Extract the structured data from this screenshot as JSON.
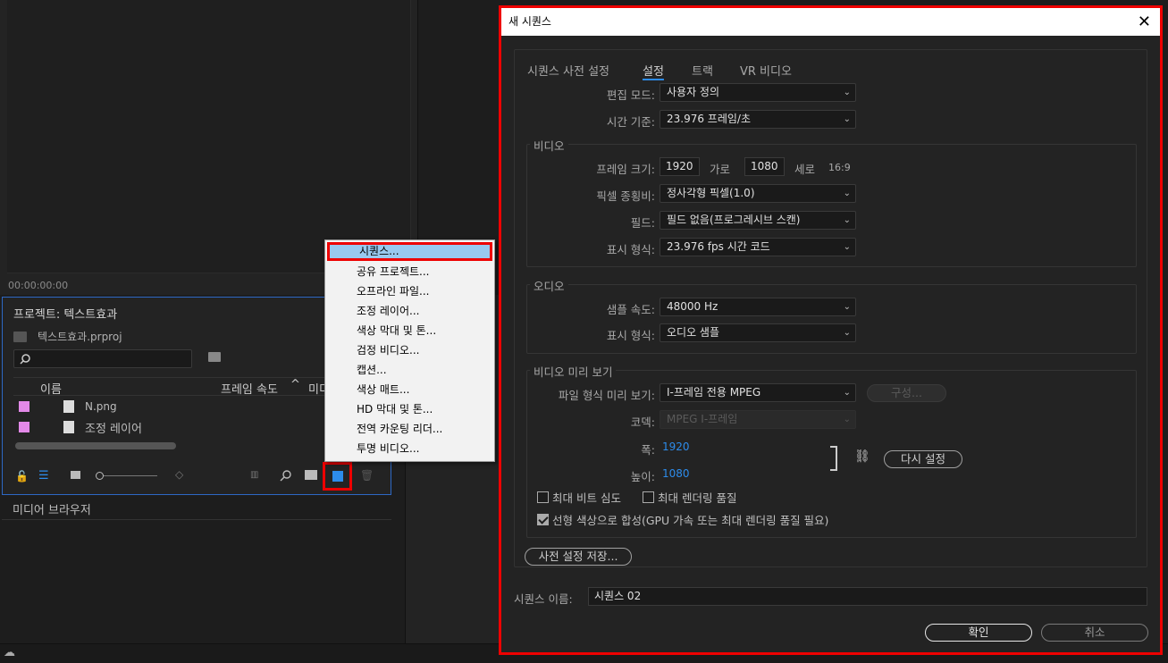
{
  "left": {
    "timecode": "00:00:00:00",
    "project_title": "프로젝트: 텍스트효과",
    "project_file": "텍스트효과.prproj",
    "columns": {
      "name": "이름",
      "frame_rate": "프레임 속도",
      "media": "미디"
    },
    "rows": [
      {
        "name": "N.png",
        "color": "#e389e8"
      },
      {
        "name": "조정 레이어",
        "color": "#e389e8"
      }
    ],
    "media_browser": "미디어 브라우저"
  },
  "menu": {
    "items": [
      "시퀀스...",
      "공유 프로젝트...",
      "오프라인 파일...",
      "조정 레이어...",
      "색상 막대 및 톤...",
      "검정 비디오...",
      "캡션...",
      "색상 매트...",
      "HD 막대 및 톤...",
      "전역 카운팅 리더...",
      "투명 비디오..."
    ]
  },
  "dialog": {
    "title": "새 시퀀스",
    "tabs": [
      "시퀀스 사전 설정",
      "설정",
      "트랙",
      "VR 비디오"
    ],
    "edit_mode": {
      "label": "편집 모드:",
      "value": "사용자 정의"
    },
    "timebase": {
      "label": "시간 기준:",
      "value": "23.976  프레임/초"
    },
    "video": {
      "title": "비디오",
      "frame_size_label": "프레임 크기:",
      "width": "1920",
      "horizontal": "가로",
      "height": "1080",
      "vertical": "세로",
      "aspect": "16:9",
      "pixel_aspect_label": "픽셀 종횡비:",
      "pixel_aspect": "정사각형 픽셀(1.0)",
      "fields_label": "필드:",
      "fields": "필드 없음(프로그레시브 스캔)",
      "display_label": "표시 형식:",
      "display": "23.976 fps 시간 코드"
    },
    "audio": {
      "title": "오디오",
      "sample_rate_label": "샘플 속도:",
      "sample_rate": "48000 Hz",
      "display_label": "표시 형식:",
      "display": "오디오 샘플"
    },
    "preview": {
      "title": "비디오 미리 보기",
      "format_label": "파일 형식 미리 보기:",
      "format": "I-프레임 전용 MPEG",
      "configure": "구성...",
      "codec_label": "코덱:",
      "codec": "MPEG I-프레임",
      "width_label": "폭:",
      "width": "1920",
      "height_label": "높이:",
      "height": "1080",
      "reset": "다시 설정"
    },
    "max_bit_depth": "최대 비트 심도",
    "max_render_quality": "최대 렌더링 품질",
    "linear_color": "선형 색상으로 합성(GPU 가속 또는 최대 렌더링 품질 필요)",
    "save_preset": "사전 설정 저장...",
    "seq_name_label": "시퀀스 이름:",
    "seq_name": "시퀀스 02",
    "ok": "확인",
    "cancel": "취소"
  }
}
